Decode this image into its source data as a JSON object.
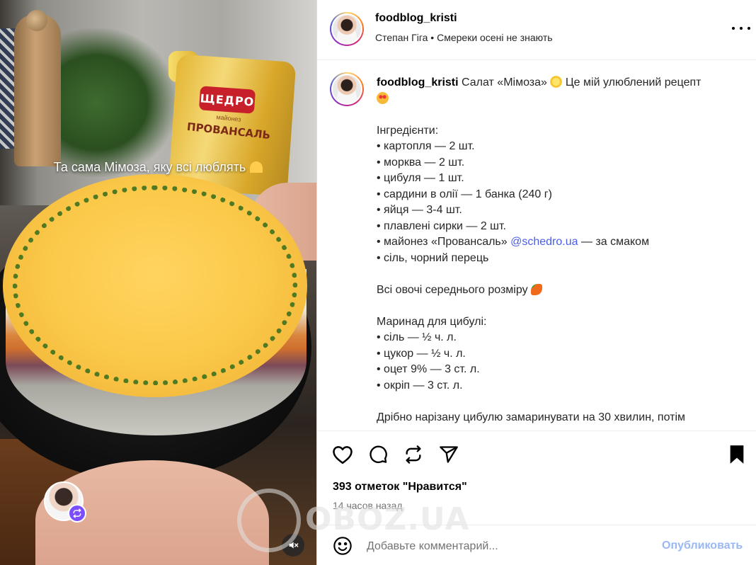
{
  "media": {
    "overlay_caption": "Та сама Мімоза, яку всі люблять",
    "packaging_brand": "ЩЕДРО",
    "packaging_subtitle": "майонез",
    "packaging_product": "ПРОВАНСАЛЬ"
  },
  "header": {
    "username": "foodblog_kristi",
    "audio": "Степан Гіга • Смереки осені не знають"
  },
  "caption": {
    "username": "foodblog_kristi",
    "first_line": "Салат «Мімоза»",
    "first_line_rest": "Це мій улюблений рецепт",
    "lines": [
      "Інгредієнти:",
      "• картопля — 2 шт.",
      "• морква — 2 шт.",
      "• цибуля — 1 шт.",
      "• сардини в олії — 1 банка (240 г)",
      "• яйця — 3-4 шт.",
      "• плавлені сирки — 2 шт."
    ],
    "mayo_prefix": "• майонез «Провансаль» ",
    "mention": "@schedro.ua",
    "mayo_suffix": " — за смаком",
    "salt_line": "• сіль, чорний перець",
    "veg_line": "Всі овочі середнього розміру",
    "marinade_lines": [
      "Маринад для цибулі:",
      "• сіль — ½ ч. л.",
      "• цукор — ½ ч. л.",
      "• оцет 9% — 3 ст. л.",
      "• окріп — 3 ст. л."
    ],
    "last_line": "Дрібно нарізану цибулю замаринувати на 30 хвилин, потім"
  },
  "actions": {
    "likes": "393 отметок \"Нравится\"",
    "time_ago": "14 часов назад"
  },
  "comment": {
    "placeholder": "Добавьте комментарий...",
    "publish_label": "Опубликовать"
  },
  "watermark": {
    "text": "OBOZ.UA"
  },
  "colors": {
    "accent_link": "#4a5de8",
    "publish_disabled": "#9ab8f5",
    "muted_text": "#737373"
  },
  "icons": [
    "heart-icon",
    "comment-icon",
    "repost-icon",
    "share-icon",
    "bookmark-icon",
    "emoji-icon",
    "more-icon",
    "mute-icon",
    "remix-icon"
  ]
}
